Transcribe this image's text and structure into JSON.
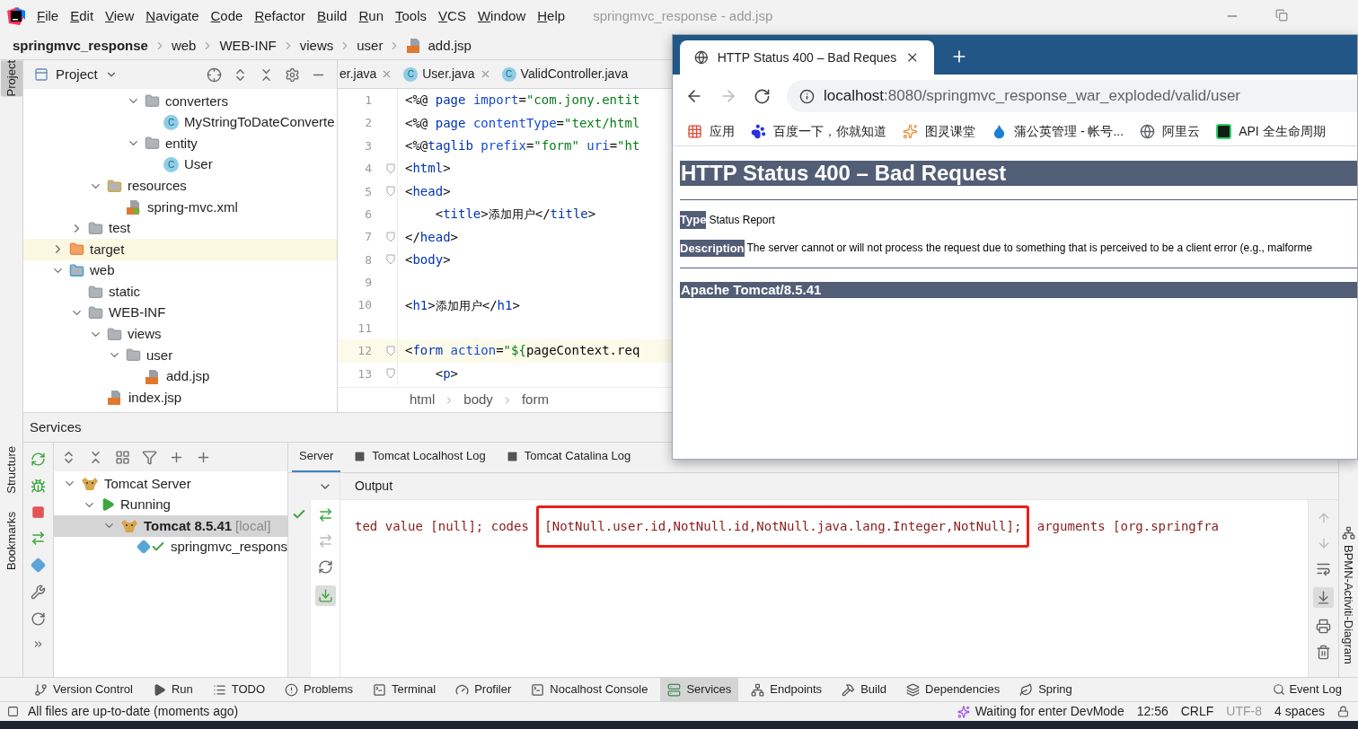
{
  "window": {
    "title": "springmvc_response - add.jsp"
  },
  "menu": [
    "File",
    "Edit",
    "View",
    "Navigate",
    "Code",
    "Refactor",
    "Build",
    "Run",
    "Tools",
    "VCS",
    "Window",
    "Help"
  ],
  "breadcrumb": [
    {
      "label": "springmvc_response",
      "kind": "project"
    },
    {
      "label": "web",
      "kind": "folder"
    },
    {
      "label": "WEB-INF",
      "kind": "folder"
    },
    {
      "label": "views",
      "kind": "folder"
    },
    {
      "label": "user",
      "kind": "folder"
    },
    {
      "label": "add.jsp",
      "kind": "jsp"
    }
  ],
  "left_strip": [
    {
      "label": "Project",
      "selected": true
    },
    {
      "label": "Structure",
      "selected": false
    },
    {
      "label": "Bookmarks",
      "selected": false
    }
  ],
  "project": {
    "title": "Project",
    "tree": [
      {
        "children": [
          {
            "children": [
              {
                "children": [
                  {
                    "children": [
                      {
                        "label": "converters",
                        "kind": "package",
                        "expanded": true,
                        "selected": false,
                        "children": [
                          {
                            "label": "MyStringToDateConverte",
                            "kind": "class",
                            "badge": "C",
                            "selected": false
                          }
                        ]
                      },
                      {
                        "label": "entity",
                        "kind": "package",
                        "expanded": true,
                        "selected": false,
                        "children": [
                          {
                            "label": "User",
                            "kind": "class",
                            "badge": "C",
                            "selected": false
                          }
                        ]
                      }
                    ]
                  }
                ]
              },
              {
                "label": "resources",
                "kind": "resources",
                "expanded": true,
                "selected": false,
                "children": [
                  {
                    "label": "spring-mvc.xml",
                    "kind": "xml",
                    "selected": false
                  }
                ]
              }
            ]
          },
          {
            "label": "test",
            "kind": "folder",
            "expanded": false,
            "selected": false
          }
        ]
      },
      {
        "label": "target",
        "kind": "excluded",
        "expanded": false,
        "selected": true
      },
      {
        "label": "web",
        "kind": "web",
        "expanded": true,
        "selected": false,
        "children": [
          {
            "label": "static",
            "kind": "folder",
            "selected": false
          },
          {
            "label": "WEB-INF",
            "kind": "folder",
            "expanded": true,
            "selected": false,
            "children": [
              {
                "label": "views",
                "kind": "folder",
                "expanded": true,
                "selected": false,
                "children": [
                  {
                    "label": "user",
                    "kind": "folder",
                    "expanded": true,
                    "selected": false,
                    "children": [
                      {
                        "label": "add.jsp",
                        "kind": "jsp",
                        "selected": false
                      }
                    ]
                  }
                ]
              },
              {
                "label": "index.jsp",
                "kind": "jsp",
                "selected": false
              }
            ]
          }
        ]
      }
    ]
  },
  "editor": {
    "tabs": [
      {
        "label": "er.java",
        "closable": true
      },
      {
        "label": "User.java",
        "badge": "C",
        "closable": true
      },
      {
        "label": "ValidController.java",
        "badge": "C",
        "closable": false
      }
    ],
    "lines": [
      {
        "num": "1",
        "current": false,
        "tokens": [
          {
            "kind": "p",
            "text": "<%@ "
          },
          {
            "kind": "k",
            "text": "page "
          },
          {
            "kind": "a",
            "text": "import"
          },
          {
            "kind": "p",
            "text": "="
          },
          {
            "kind": "s",
            "text": "\"com.jony.entit"
          }
        ]
      },
      {
        "num": "2",
        "current": false,
        "tokens": [
          {
            "kind": "p",
            "text": "<%@ "
          },
          {
            "kind": "k",
            "text": "page "
          },
          {
            "kind": "a",
            "text": "contentType"
          },
          {
            "kind": "p",
            "text": "="
          },
          {
            "kind": "s",
            "text": "\"text/html"
          }
        ]
      },
      {
        "num": "3",
        "current": false,
        "tokens": [
          {
            "kind": "p",
            "text": "<%@"
          },
          {
            "kind": "k",
            "text": "taglib "
          },
          {
            "kind": "a",
            "text": "prefix"
          },
          {
            "kind": "p",
            "text": "="
          },
          {
            "kind": "s",
            "text": "\"form\" "
          },
          {
            "kind": "a",
            "text": "uri"
          },
          {
            "kind": "p",
            "text": "="
          },
          {
            "kind": "s",
            "text": "\"ht"
          }
        ]
      },
      {
        "num": "4",
        "current": false,
        "fold": true,
        "tokens": [
          {
            "kind": "p",
            "text": "<"
          },
          {
            "kind": "k",
            "text": "html"
          },
          {
            "kind": "p",
            "text": ">"
          }
        ]
      },
      {
        "num": "5",
        "current": false,
        "fold": true,
        "tokens": [
          {
            "kind": "p",
            "text": "<"
          },
          {
            "kind": "k",
            "text": "head"
          },
          {
            "kind": "p",
            "text": ">"
          }
        ]
      },
      {
        "num": "6",
        "current": false,
        "tokens": [
          {
            "kind": "p",
            "text": "    <"
          },
          {
            "kind": "k",
            "text": "title"
          },
          {
            "kind": "p",
            "text": ">"
          },
          {
            "kind": "t",
            "text": "添加用户"
          },
          {
            "kind": "p",
            "text": "</"
          },
          {
            "kind": "k",
            "text": "title"
          },
          {
            "kind": "p",
            "text": ">"
          }
        ]
      },
      {
        "num": "7",
        "current": false,
        "fold": true,
        "tokens": [
          {
            "kind": "p",
            "text": "</"
          },
          {
            "kind": "k",
            "text": "head"
          },
          {
            "kind": "p",
            "text": ">"
          }
        ]
      },
      {
        "num": "8",
        "current": false,
        "fold": true,
        "tokens": [
          {
            "kind": "p",
            "text": "<"
          },
          {
            "kind": "k",
            "text": "body"
          },
          {
            "kind": "p",
            "text": ">"
          }
        ]
      },
      {
        "num": "9",
        "current": false
      },
      {
        "num": "10",
        "current": false,
        "tokens": [
          {
            "kind": "p",
            "text": "<"
          },
          {
            "kind": "k",
            "text": "h1"
          },
          {
            "kind": "p",
            "text": ">"
          },
          {
            "kind": "t",
            "text": "添加用户"
          },
          {
            "kind": "p",
            "text": "</"
          },
          {
            "kind": "k",
            "text": "h1"
          },
          {
            "kind": "p",
            "text": ">"
          }
        ]
      },
      {
        "num": "11",
        "current": false
      },
      {
        "num": "12",
        "current": true,
        "fold": true,
        "tokens": [
          {
            "kind": "p",
            "text": "<"
          },
          {
            "kind": "k",
            "text": "form "
          },
          {
            "kind": "a",
            "text": "action"
          },
          {
            "kind": "p",
            "text": "="
          },
          {
            "kind": "s",
            "text": "\"${"
          },
          {
            "kind": "p",
            "text": "pageContext.req"
          }
        ]
      },
      {
        "num": "13",
        "current": false,
        "fold": true,
        "tokens": [
          {
            "kind": "p",
            "text": "    <"
          },
          {
            "kind": "k",
            "text": "p"
          },
          {
            "kind": "p",
            "text": ">"
          }
        ]
      }
    ],
    "path": [
      "html",
      "body",
      "form"
    ]
  },
  "services": {
    "title": "Services",
    "tree": [
      {
        "label": "Tomcat Server",
        "kind": "server",
        "expanded": true,
        "selected": false,
        "children": [
          {
            "label": "Running",
            "kind": "running",
            "expanded": true,
            "selected": false,
            "children": [
              {
                "label": "Tomcat 8.5.41",
                "suffix": "[local]",
                "kind": "tomcat",
                "expanded": true,
                "selected": true,
                "children": [
                  {
                    "label": "springmvc_respons",
                    "kind": "artifact",
                    "selected": false
                  }
                ]
              }
            ]
          }
        ]
      }
    ],
    "tabs": [
      {
        "label": "Server",
        "selected": true
      },
      {
        "label": "Tomcat Localhost Log",
        "selected": false
      },
      {
        "label": "Tomcat Catalina Log",
        "selected": false
      }
    ],
    "output_header": "Output",
    "output": {
      "before": "ted value [null]; codes ",
      "highlighted": "[NotNull.user.id,NotNull.id,NotNull.java.lang.Integer,NotNull];",
      "after": " arguments [org.springfra"
    }
  },
  "right_strip": {
    "label": "BPMN-Activiti-Diagram"
  },
  "browser": {
    "tab_title": "HTTP Status 400 – Bad Reques",
    "url_host": "localhost",
    "url_path": ":8080/springmvc_response_war_exploded/valid/user",
    "bookmarks": [
      {
        "label": "应用",
        "kind": "apps"
      },
      {
        "label": "百度一下，你就知道",
        "kind": "paw"
      },
      {
        "label": "图灵课堂",
        "kind": "site"
      },
      {
        "label": "蒲公英管理 - 帐号...",
        "kind": "drop"
      },
      {
        "label": "阿里云",
        "kind": "globe"
      },
      {
        "label": "API 全生命周期",
        "kind": "api"
      }
    ],
    "heading": "HTTP Status 400 – Bad Request",
    "fields": [
      {
        "label": "Type",
        "text": "Status Report"
      },
      {
        "label": "Description",
        "text": "The server cannot or will not process the request due to something that is perceived to be a client error (e.g., malforme"
      }
    ],
    "footer": "Apache Tomcat/8.5.41"
  },
  "tool_windows": [
    {
      "label": "Version Control",
      "kind": "branch",
      "selected": false
    },
    {
      "label": "Run",
      "kind": "run",
      "selected": false
    },
    {
      "label": "TODO",
      "kind": "list",
      "selected": false
    },
    {
      "label": "Problems",
      "kind": "problems",
      "selected": false
    },
    {
      "label": "Terminal",
      "kind": "terminal",
      "selected": false
    },
    {
      "label": "Profiler",
      "kind": "profiler",
      "selected": false
    },
    {
      "label": "Nocalhost Console",
      "kind": "terminal",
      "selected": false
    },
    {
      "label": "Services",
      "kind": "services",
      "selected": true
    },
    {
      "label": "Endpoints",
      "kind": "endpoints",
      "selected": false
    },
    {
      "label": "Build",
      "kind": "build",
      "selected": false
    },
    {
      "label": "Dependencies",
      "kind": "deps",
      "selected": false
    },
    {
      "label": "Spring",
      "kind": "spring",
      "selected": false
    }
  ],
  "event_log": "Event Log",
  "status_bar": {
    "message": "All files are up-to-date (moments ago)",
    "devmode": "Waiting for enter DevMode",
    "position": "12:56",
    "line_sep": "CRLF",
    "encoding": "UTF-8",
    "indent": "4 spaces"
  }
}
